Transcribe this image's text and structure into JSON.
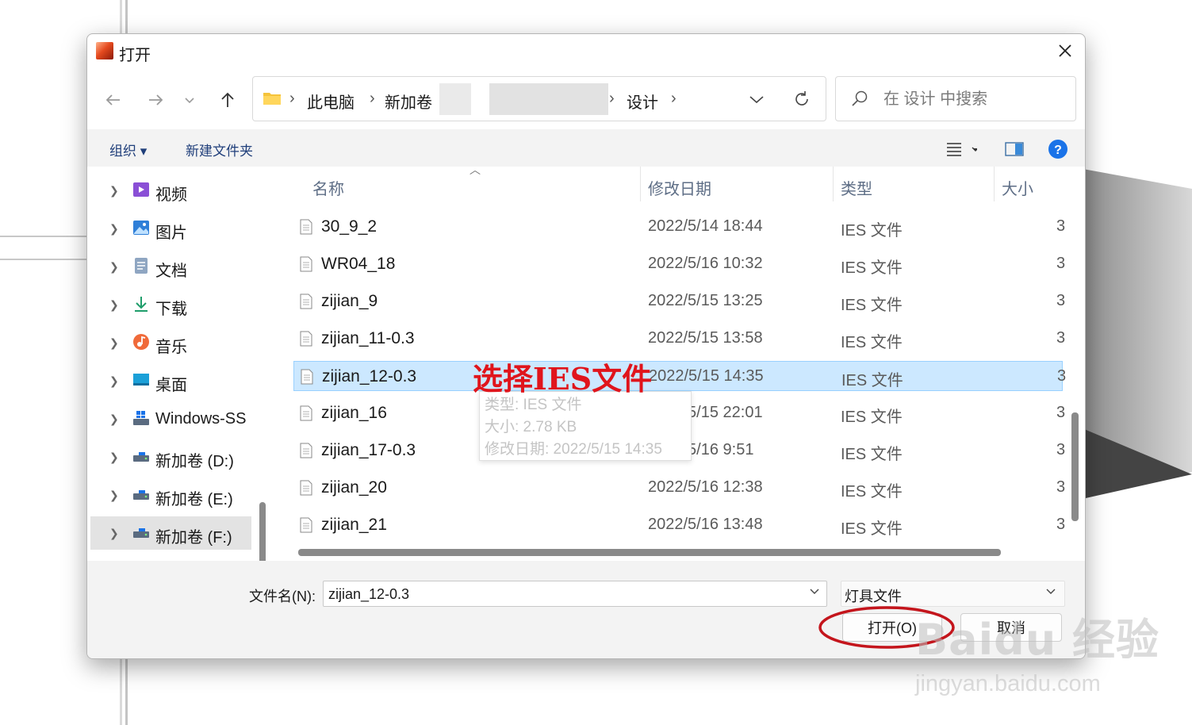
{
  "dialog": {
    "title": "打开",
    "close_icon": "close-icon"
  },
  "nav": {
    "back_icon": "arrow-left-icon",
    "forward_icon": "arrow-right-icon",
    "recent_icon": "chevron-down-icon",
    "up_icon": "arrow-up-icon"
  },
  "address": {
    "crumbs": [
      "此电脑",
      "新加卷",
      "设计"
    ],
    "separator": "›",
    "dropdown_icon": "chevron-down-icon",
    "refresh_icon": "refresh-icon"
  },
  "search": {
    "placeholder": "在 设计 中搜索"
  },
  "toolbar": {
    "organize_label": "组织 ▾",
    "new_folder_label": "新建文件夹",
    "view_icon": "list-view-icon",
    "preview_icon": "preview-pane-icon",
    "help_icon": "help-icon"
  },
  "sidebar": {
    "items": [
      {
        "label": "视频",
        "icon": "video-folder-icon"
      },
      {
        "label": "图片",
        "icon": "pictures-folder-icon"
      },
      {
        "label": "文档",
        "icon": "documents-folder-icon"
      },
      {
        "label": "下载",
        "icon": "download-icon"
      },
      {
        "label": "音乐",
        "icon": "music-icon"
      },
      {
        "label": "桌面",
        "icon": "desktop-icon"
      },
      {
        "label": "Windows-SS",
        "icon": "system-drive-icon"
      },
      {
        "label": "新加卷 (D:)",
        "icon": "drive-icon"
      },
      {
        "label": "新加卷 (E:)",
        "icon": "drive-icon"
      },
      {
        "label": "新加卷 (F:)",
        "icon": "drive-icon"
      }
    ],
    "selected_index": 9
  },
  "columns": {
    "name": "名称",
    "date": "修改日期",
    "type": "类型",
    "size": "大小"
  },
  "files": [
    {
      "name": "30_9_2",
      "date": "2022/5/14 18:44",
      "type": "IES 文件",
      "size": "3"
    },
    {
      "name": "WR04_18",
      "date": "2022/5/16 10:32",
      "type": "IES 文件",
      "size": "3"
    },
    {
      "name": "zijian_9",
      "date": "2022/5/15 13:25",
      "type": "IES 文件",
      "size": "3"
    },
    {
      "name": "zijian_11-0.3",
      "date": "2022/5/15 13:58",
      "type": "IES 文件",
      "size": "3"
    },
    {
      "name": "zijian_12-0.3",
      "date": "2022/5/15 14:35",
      "type": "IES 文件",
      "size": "3"
    },
    {
      "name": "zijian_16",
      "date": "2022/5/15 22:01",
      "type": "IES 文件",
      "size": "3"
    },
    {
      "name": "zijian_17-0.3",
      "date": "2022/5/16 9:51",
      "type": "IES 文件",
      "size": "3"
    },
    {
      "name": "zijian_20",
      "date": "2022/5/16 12:38",
      "type": "IES 文件",
      "size": "3"
    },
    {
      "name": "zijian_21",
      "date": "2022/5/16 13:48",
      "type": "IES 文件",
      "size": "3"
    }
  ],
  "selected_file_index": 4,
  "tooltip": {
    "type_line": "类型: IES 文件",
    "size_line": "大小: 2.78 KB",
    "date_line": "修改日期: 2022/5/15 14:35"
  },
  "annotation": {
    "text": "选择IES文件",
    "color": "#e0151c"
  },
  "footer": {
    "filename_label": "文件名(N):",
    "filename_value": "zijian_12-0.3",
    "filetype_value": "灯具文件",
    "open_button": "打开(O)",
    "cancel_button": "取消"
  },
  "watermark": {
    "brand": "Baidu 经验",
    "url": "jingyan.baidu.com"
  },
  "colors": {
    "selection_bg": "#cce8ff",
    "selection_border": "#99d1ff",
    "accent": "#1a73e8",
    "annotation_red": "#e0151c"
  }
}
